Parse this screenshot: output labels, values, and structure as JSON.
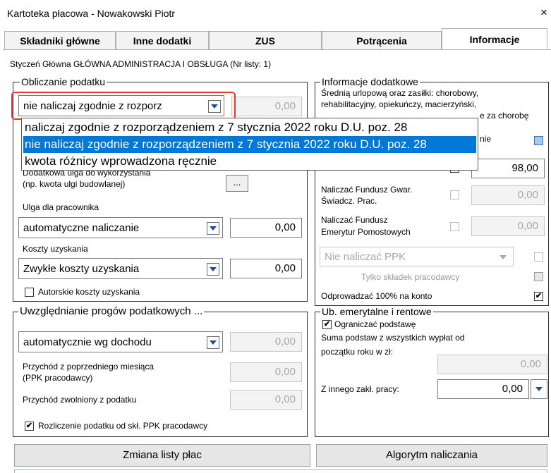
{
  "window": {
    "title": "Kartoteka płacowa - Nowakowski Piotr",
    "close": "×"
  },
  "tabs": [
    "Składniki główne",
    "Inne dodatki",
    "ZUS",
    "Potrącenia",
    "Informacje"
  ],
  "subtitle": "Styczeń Główna GŁÓWNA ADMINISTRACJA I OBSŁUGA  (Nr listy: 1)",
  "tax": {
    "title": "Obliczanie podatku",
    "combo": "nie naliczaj zgodnie z rozporz",
    "value": "0,00",
    "dropdown": [
      "naliczaj zgodnie z rozporządzeniem z 7 stycznia 2022 roku D.U. poz. 28",
      "nie naliczaj zgodnie z rozporządzeniem z 7 stycznia 2022 roku D.U. poz. 28",
      "kwota różnicy wprowadzona ręcznie"
    ],
    "extra_relief_label": "Dodatkowa ulga do wykorzystania",
    "extra_relief_sub": "(np. kwota ulgi budowlanej)",
    "ellipsis": "...",
    "employee_relief_label": "Ulga dla pracownika",
    "employee_relief_combo": "automatyczne naliczanie",
    "employee_relief_value": "0,00",
    "costs_label": "Koszty uzyskania",
    "costs_combo": "Zwykłe koszty uzyskania",
    "costs_value": "0,00",
    "author_costs": "Autorskie koszty uzyskania"
  },
  "thresholds": {
    "title": "Uwzględnianie progów podatkowych ...",
    "combo": "automatycznie wg dochodu",
    "value": "0,00",
    "prev_income_label1": "Przychód z poprzedniego miesiąca",
    "prev_income_label2": "(PPK pracodawcy)",
    "prev_income_value": "0,00",
    "exempt_label": "Przychód zwolniony z podatku",
    "exempt_value": "0,00",
    "ppk_settlement": "Rozliczenie podatku od skł. PPK pracodawcy"
  },
  "info": {
    "title": "Informacje dodatkowe",
    "line1": "Średnią urlopową oraz zasiłki: chorobowy,",
    "line2": "rehabilitacyjny, opiekuńczy, macierzyński,",
    "line3_tail": "e za chorobę",
    "line4_tail": "nie",
    "value": "98,00",
    "fgsp_label1": "Naliczać Fundusz Gwar.",
    "fgsp_label2": "Świadcz. Prac.",
    "fgsp_value": "0,00",
    "fep_label1": "Naliczać Fundusz",
    "fep_label2": "Emerytur Pomostowych",
    "fep_value": "0,00",
    "ppk_combo": "Nie naliczać PPK",
    "ppk_employer_only": "Tylko składek pracodawcy",
    "transfer_label": "Odprowadzać 100% na konto"
  },
  "pension": {
    "title": "Ub. emerytalne i rentowe",
    "limit_label": "Ograniczać podstawę",
    "sum_label1": "Suma podstaw z wszystkich wypłat od",
    "sum_label2": "początku roku w zł:",
    "sum_value": "0,00",
    "other_label": "Z innego zakł. pracy:",
    "other_value": "0,00"
  },
  "buttons": {
    "change_list": "Zmiana listy płac",
    "algorithm": "Algorytm naliczania"
  },
  "checkmark": "✔"
}
